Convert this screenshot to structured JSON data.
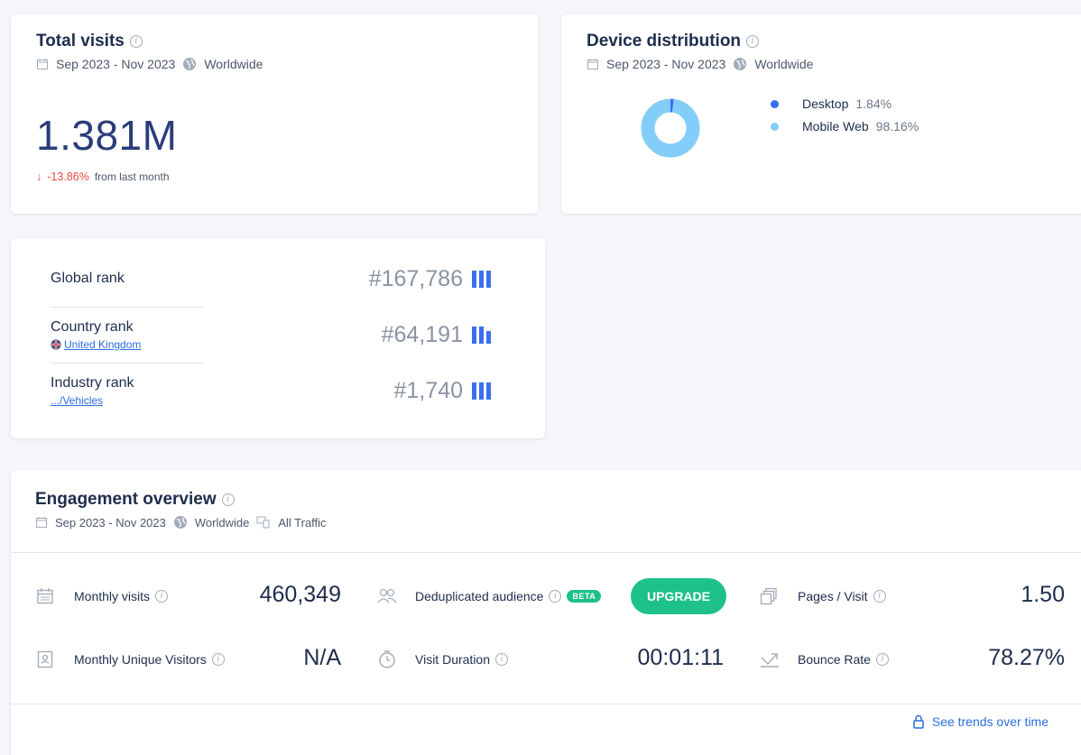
{
  "total_visits": {
    "title": "Total visits",
    "date_range": "Sep 2023 - Nov 2023",
    "region": "Worldwide",
    "value": "1.381M",
    "change": "-13.86%",
    "change_suffix": "from last month"
  },
  "device_distribution": {
    "title": "Device distribution",
    "date_range": "Sep 2023 - Nov 2023",
    "region": "Worldwide",
    "items": [
      {
        "label": "Desktop",
        "value": "1.84%",
        "share": 1.84,
        "color": "#3a6ff0"
      },
      {
        "label": "Mobile Web",
        "value": "98.16%",
        "share": 98.16,
        "color": "#82cef8"
      }
    ]
  },
  "ranks": [
    {
      "label": "Global rank",
      "sub": "",
      "value": "#167,786"
    },
    {
      "label": "Country rank",
      "sub": "United Kingdom",
      "value": "#64,191"
    },
    {
      "label": "Industry rank",
      "sub": ".../Vehicles",
      "value": "#1,740"
    }
  ],
  "engagement": {
    "title": "Engagement overview",
    "date_range": "Sep 2023 - Nov 2023",
    "region": "Worldwide",
    "traffic": "All Traffic",
    "monthly_visits_label": "Monthly visits",
    "monthly_visits_value": "460,349",
    "dedup_label": "Deduplicated audience",
    "beta_label": "BETA",
    "upgrade_label": "UPGRADE",
    "pages_visit_label": "Pages / Visit",
    "pages_visit_value": "1.50",
    "unique_label": "Monthly Unique Visitors",
    "unique_value": "N/A",
    "duration_label": "Visit Duration",
    "duration_value": "00:01:11",
    "bounce_label": "Bounce Rate",
    "bounce_value": "78.27%",
    "trends_label": "See trends over time"
  },
  "colors": {
    "accent": "#3a6ff0",
    "green": "#1fc18b",
    "negative": "#e8473c",
    "link": "#2a6ee0"
  }
}
